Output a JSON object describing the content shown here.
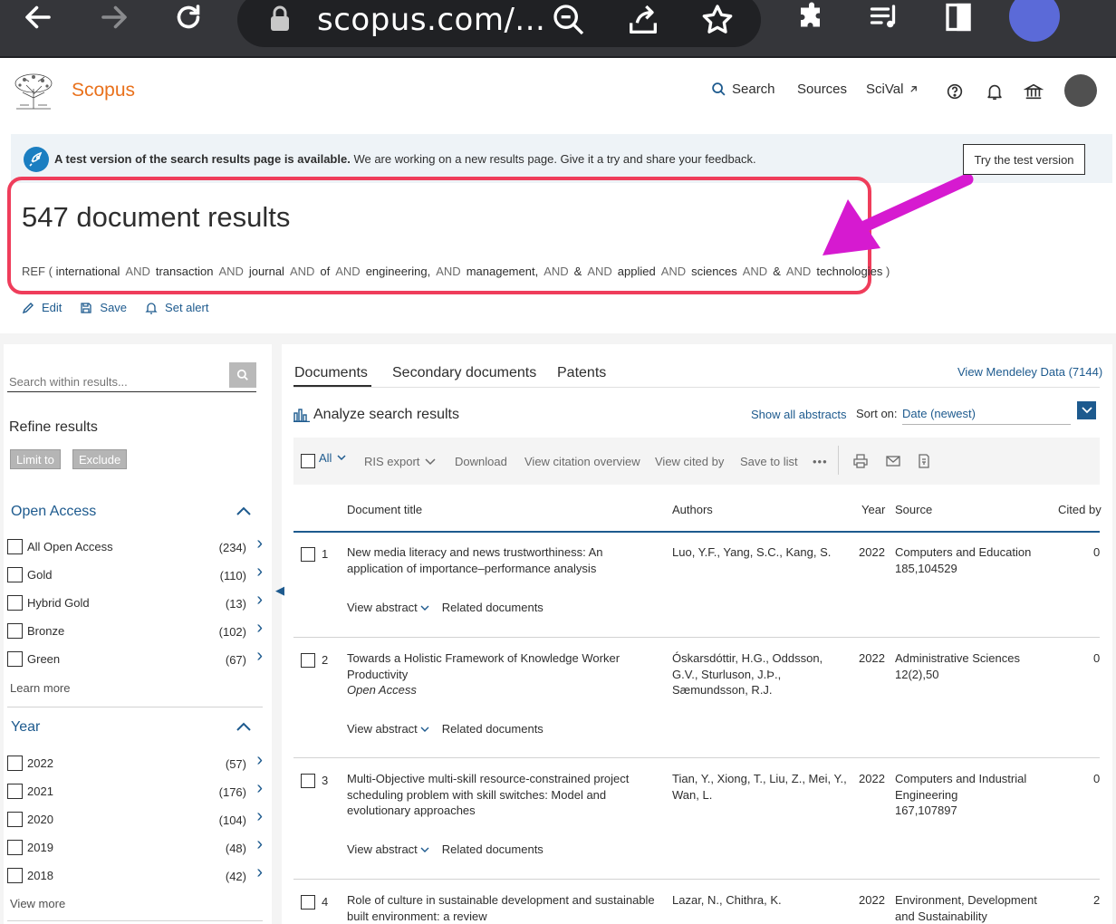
{
  "browser": {
    "url": "scopus.com/...",
    "colors": {
      "chrome": "#35363a",
      "urlbar": "#202124",
      "profile": "#5b6ad8"
    }
  },
  "header": {
    "brand": "Scopus",
    "nav": {
      "search": "Search",
      "sources": "Sources",
      "scival": "SciVal"
    },
    "colors": {
      "brand": "#e9711c",
      "link": "#1d5a8e"
    }
  },
  "banner": {
    "bold_text": "A test version of the search results page is available.",
    "text": " We are working on a new results page. Give it a try and share your feedback.",
    "button": "Try the test version"
  },
  "results": {
    "count_label": "547 document results",
    "query_prefix": "REF (",
    "query_terms": [
      "international",
      "transaction",
      "journal",
      "of",
      "engineering,",
      "management,",
      "&",
      "applied",
      "sciences",
      "&",
      "technologies"
    ],
    "operator": "AND",
    "query_suffix": ")",
    "actions": {
      "edit": "Edit",
      "save": "Save",
      "set_alert": "Set alert"
    },
    "highlight_color": "#ef3d5b",
    "arrow_color": "#d61ad0"
  },
  "sidebar": {
    "search_placeholder": "Search within results...",
    "refine_title": "Refine results",
    "limit_to": "Limit to",
    "exclude": "Exclude",
    "open_access": {
      "title": "Open Access",
      "items": [
        {
          "label": "All Open Access",
          "count": "(234)"
        },
        {
          "label": "Gold",
          "count": "(110)"
        },
        {
          "label": "Hybrid Gold",
          "count": "(13)"
        },
        {
          "label": "Bronze",
          "count": "(102)"
        },
        {
          "label": "Green",
          "count": "(67)"
        }
      ],
      "more": "Learn more"
    },
    "year": {
      "title": "Year",
      "items": [
        {
          "label": "2022",
          "count": "(57)"
        },
        {
          "label": "2021",
          "count": "(176)"
        },
        {
          "label": "2020",
          "count": "(104)"
        },
        {
          "label": "2019",
          "count": "(48)"
        },
        {
          "label": "2018",
          "count": "(42)"
        }
      ],
      "more": "View more"
    }
  },
  "main": {
    "tabs": [
      "Documents",
      "Secondary documents",
      "Patents"
    ],
    "mendeley": "View Mendeley Data (7144)",
    "analyze": "Analyze search results",
    "show_abstracts": "Show all abstracts",
    "sort_label": "Sort on:",
    "sort_value": "Date (newest)",
    "toolbar": {
      "all": "All",
      "ris": "RIS export",
      "download": "Download",
      "citation_overview": "View citation overview",
      "cited_by": "View cited by",
      "save_list": "Save to list",
      "more": "•••"
    },
    "columns": {
      "title": "Document title",
      "authors": "Authors",
      "year": "Year",
      "source": "Source",
      "cited": "Cited by"
    },
    "view_abstract": "View abstract",
    "related": "Related documents",
    "rows": [
      {
        "num": "1",
        "title": "New media literacy and news trustworthiness: An application of importance–performance analysis",
        "oa": "",
        "authors": "Luo, Y.F., Yang, S.C., Kang, S.",
        "year": "2022",
        "source": "Computers and Education",
        "source_detail": "185,104529",
        "cited": "0"
      },
      {
        "num": "2",
        "title": "Towards a Holistic Framework of Knowledge Worker Productivity",
        "oa": "Open Access",
        "authors": "Óskarsdóttir, H.G., Oddsson, G.V., Sturluson, J.Þ., Sæmundsson, R.J.",
        "year": "2022",
        "source": "Administrative Sciences",
        "source_detail": "12(2),50",
        "cited": "0"
      },
      {
        "num": "3",
        "title": "Multi-Objective multi-skill resource-constrained project scheduling problem with skill switches: Model and evolutionary approaches",
        "oa": "",
        "authors": "Tian, Y., Xiong, T., Liu, Z., Mei, Y., Wan, L.",
        "year": "2022",
        "source": "Computers and Industrial Engineering",
        "source_detail": "167,107897",
        "cited": "0"
      },
      {
        "num": "4",
        "title": "Role of culture in sustainable development and sustainable built environment: a review",
        "oa": "",
        "authors": "Lazar, N., Chithra, K.",
        "year": "2022",
        "source": "Environment, Development and Sustainability",
        "source_detail": "",
        "cited": "2"
      }
    ]
  }
}
